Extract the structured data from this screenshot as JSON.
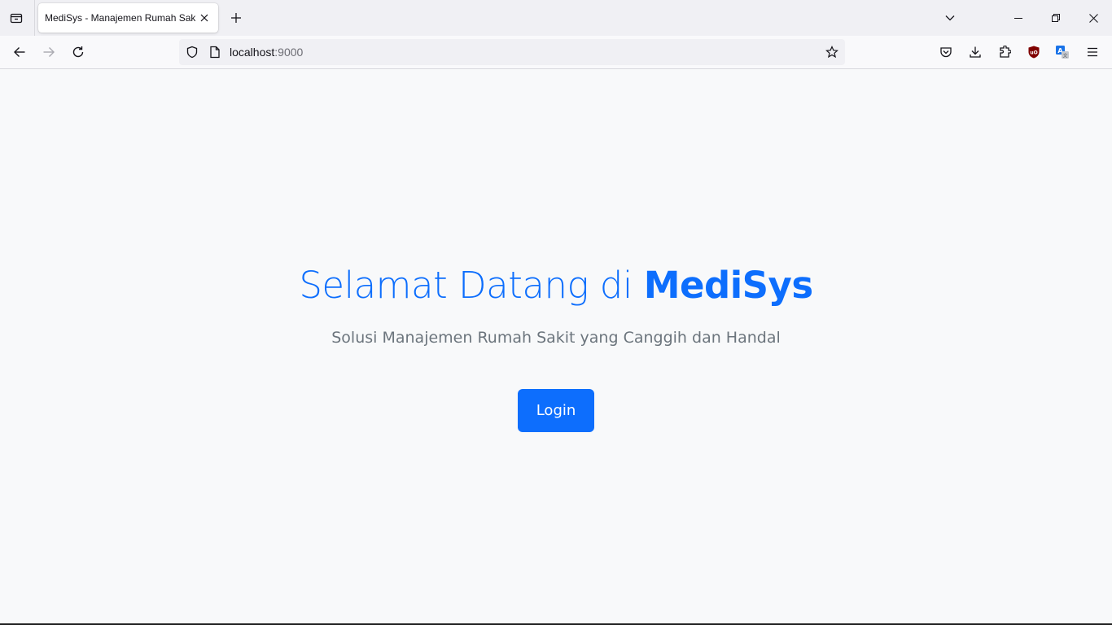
{
  "browser": {
    "tab": {
      "title": "MediSys - Manajemen Rumah Sakit"
    },
    "url": {
      "host": "localhost",
      "port": ":9000"
    },
    "icons": {
      "tab_list": "tab-list-icon",
      "tab_close": "close-icon",
      "new_tab": "plus-icon",
      "tabs_overflow": "chevron-down-icon",
      "minimize": "minimize-icon",
      "restore": "restore-icon",
      "close_window": "close-icon",
      "back": "arrow-left-icon",
      "forward": "arrow-right-icon",
      "reload": "reload-icon",
      "tracking_protection": "shield-icon",
      "page_info": "page-icon",
      "bookmark": "star-icon",
      "pocket": "pocket-icon",
      "downloads": "download-icon",
      "extensions": "puzzle-icon",
      "ublock": "ublock-icon",
      "translate": "translate-icon",
      "menu": "hamburger-menu-icon"
    },
    "colors": {
      "ublock": "#800000",
      "translate": "#1a73e8"
    }
  },
  "page": {
    "title_prefix": "Selamat Datang di ",
    "title_brand": "MediSys",
    "subtitle": "Solusi Manajemen Rumah Sakit yang Canggih dan Handal",
    "login_label": "Login",
    "colors": {
      "primary": "#0d6efd",
      "muted": "#6c757d",
      "background": "#f8f9fa"
    }
  }
}
